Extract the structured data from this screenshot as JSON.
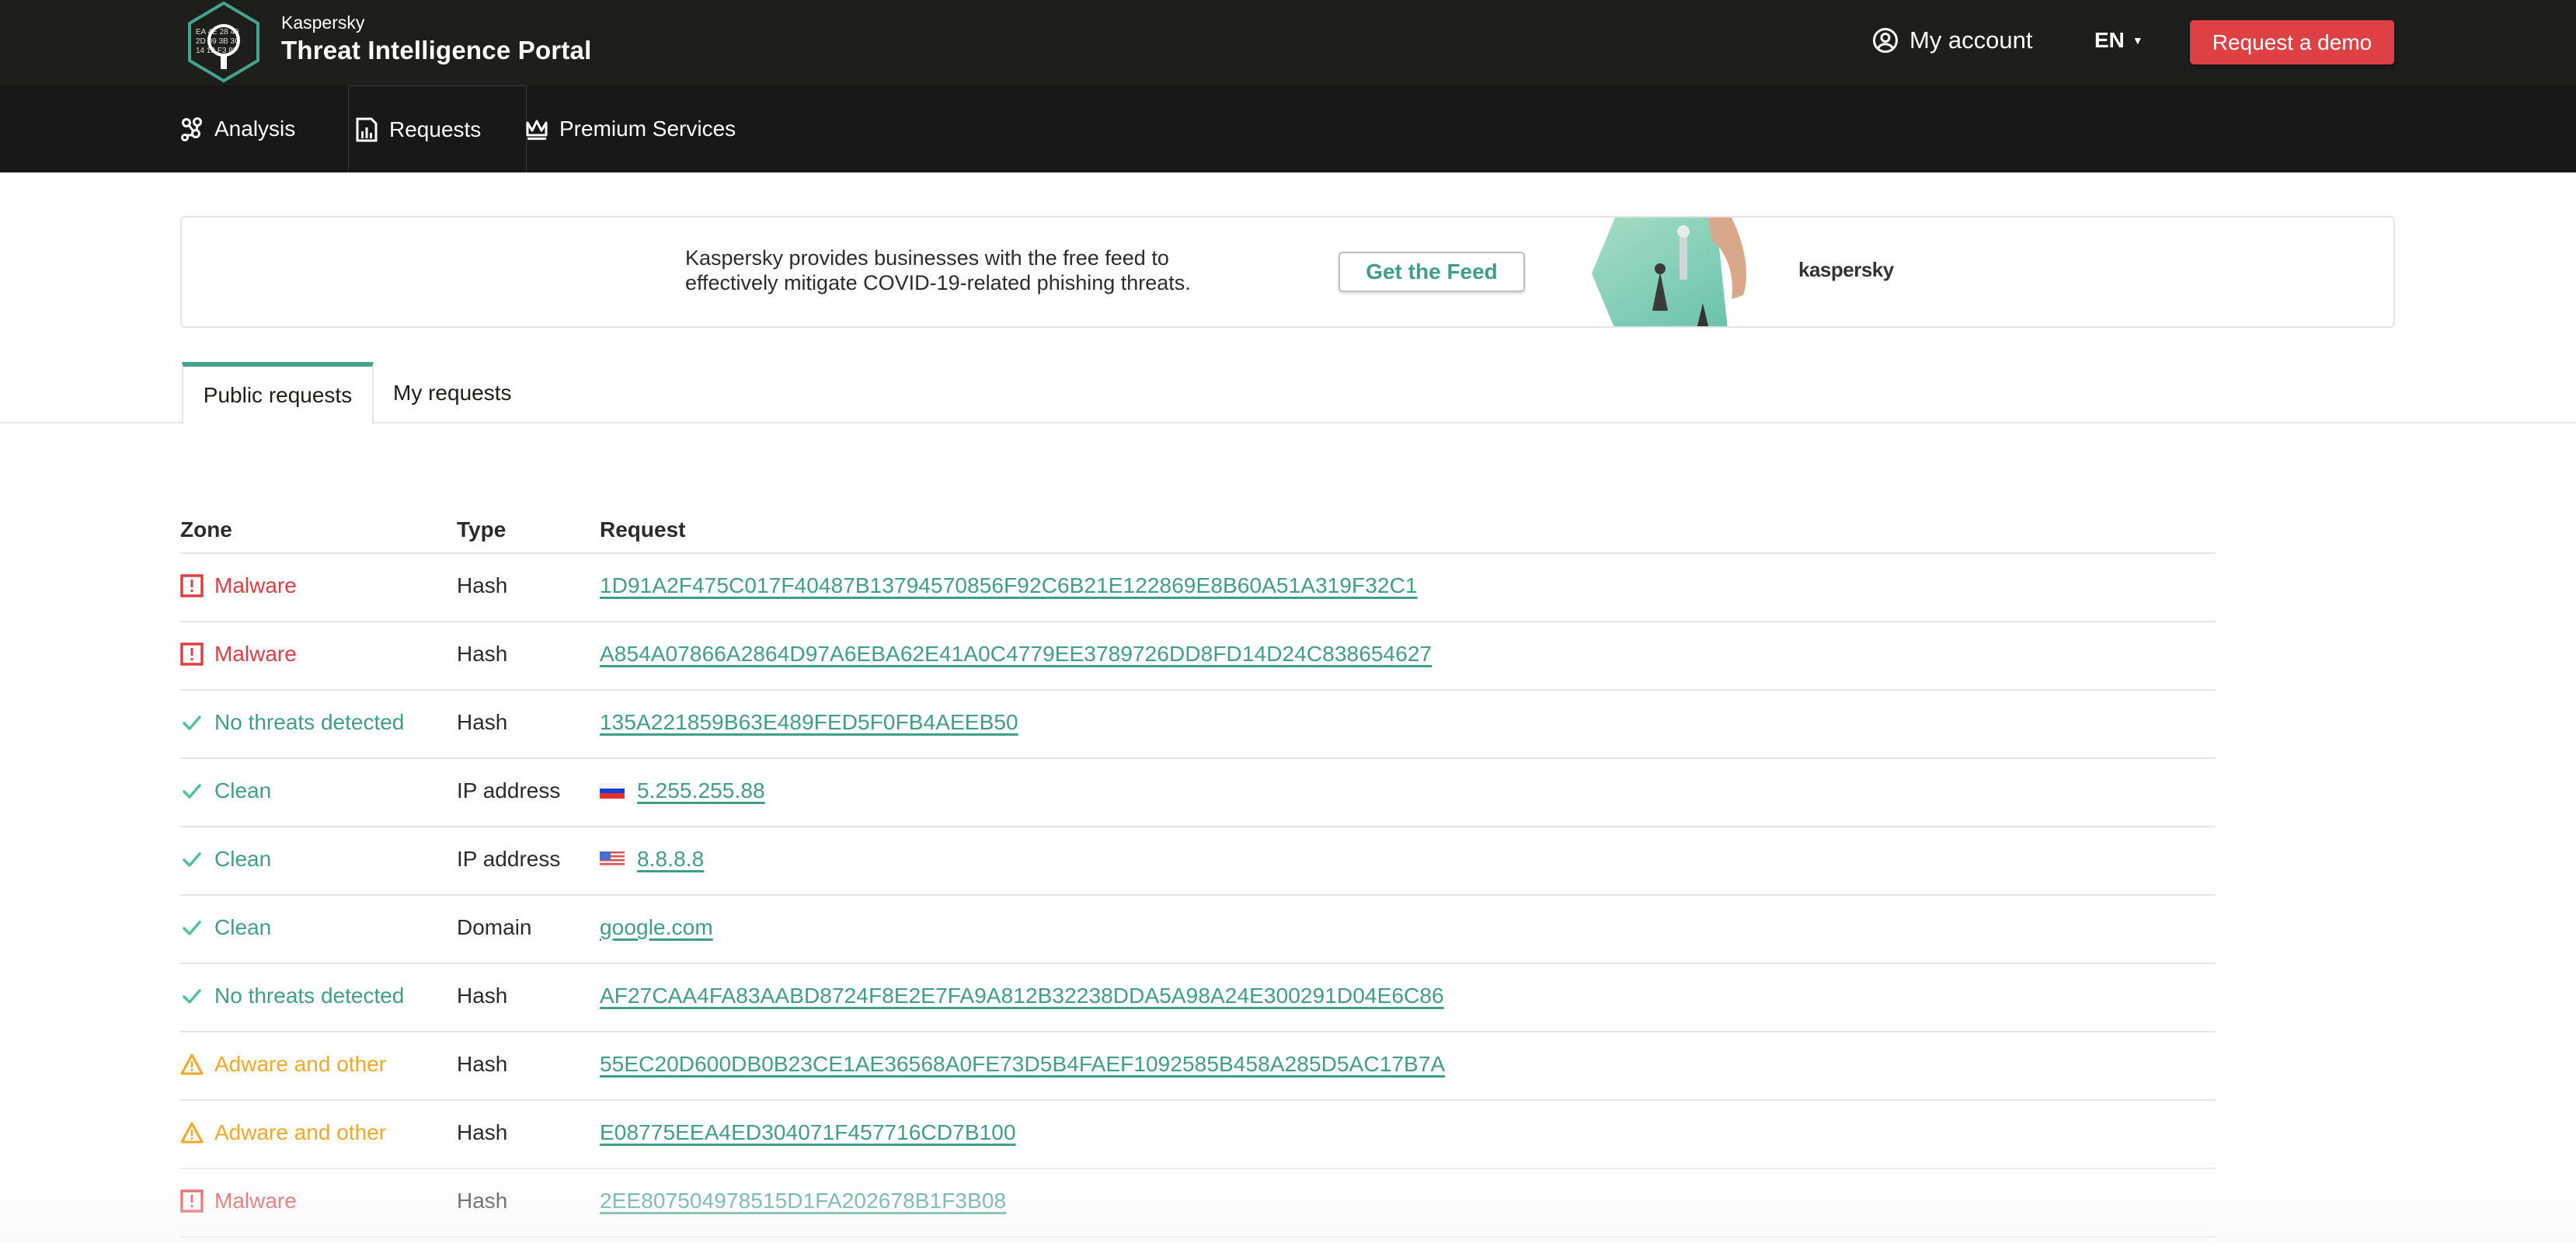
{
  "header": {
    "brand_small": "Kaspersky",
    "brand_title": "Threat Intelligence Portal",
    "account_label": "My account",
    "language": "EN",
    "demo_button": "Request a demo"
  },
  "nav": {
    "items": [
      {
        "label": "Analysis",
        "icon": "analysis-graph-icon"
      },
      {
        "label": "Requests",
        "icon": "requests-chart-icon",
        "active": true
      },
      {
        "label": "Premium Services",
        "icon": "crown-icon"
      }
    ]
  },
  "banner": {
    "text_line1": "Kaspersky provides businesses with the free feed to",
    "text_line2": "effectively mitigate COVID-19-related phishing threats.",
    "button": "Get the Feed",
    "brand": "kaspersky"
  },
  "tabs": [
    {
      "label": "Public requests",
      "active": true
    },
    {
      "label": "My requests",
      "active": false
    }
  ],
  "table": {
    "columns": [
      "Zone",
      "Type",
      "Request"
    ],
    "rows": [
      {
        "zone": "Malware",
        "zone_kind": "malware",
        "type": "Hash",
        "request": "1D91A2F475C017F40487B13794570856F92C6B21E122869E8B60A51A319F32C1"
      },
      {
        "zone": "Malware",
        "zone_kind": "malware",
        "type": "Hash",
        "request": "A854A07866A2864D97A6EBA62E41A0C4779EE3789726DD8FD14D24C838654627"
      },
      {
        "zone": "No threats detected",
        "zone_kind": "clean",
        "type": "Hash",
        "request": "135A221859B63E489FED5F0FB4AEEB50"
      },
      {
        "zone": "Clean",
        "zone_kind": "clean",
        "type": "IP address",
        "flag": "ru",
        "request": "5.255.255.88"
      },
      {
        "zone": "Clean",
        "zone_kind": "clean",
        "type": "IP address",
        "flag": "us",
        "request": "8.8.8.8"
      },
      {
        "zone": "Clean",
        "zone_kind": "clean",
        "type": "Domain",
        "request": "google.com"
      },
      {
        "zone": "No threats detected",
        "zone_kind": "clean",
        "type": "Hash",
        "request": "AF27CAA4FA83AABD8724F8E2E7FA9A812B32238DDA5A98A24E300291D04E6C86"
      },
      {
        "zone": "Adware and other",
        "zone_kind": "adware",
        "type": "Hash",
        "request": "55EC20D600DB0B23CE1AE36568A0FE73D5B4FAEF1092585B458A285D5AC17B7A"
      },
      {
        "zone": "Adware and other",
        "zone_kind": "adware",
        "type": "Hash",
        "request": "E08775EEA4ED304071F457716CD7B100"
      },
      {
        "zone": "Malware",
        "zone_kind": "malware",
        "type": "Hash",
        "request": "2EE807504978515D1FA202678B1F3B08"
      }
    ]
  },
  "colors": {
    "accent": "#3f9e85",
    "malware": "#de3f43",
    "adware": "#f5a623",
    "demo_button": "#de4043",
    "topbar": "#1e1e1c",
    "navbar": "#181818"
  }
}
